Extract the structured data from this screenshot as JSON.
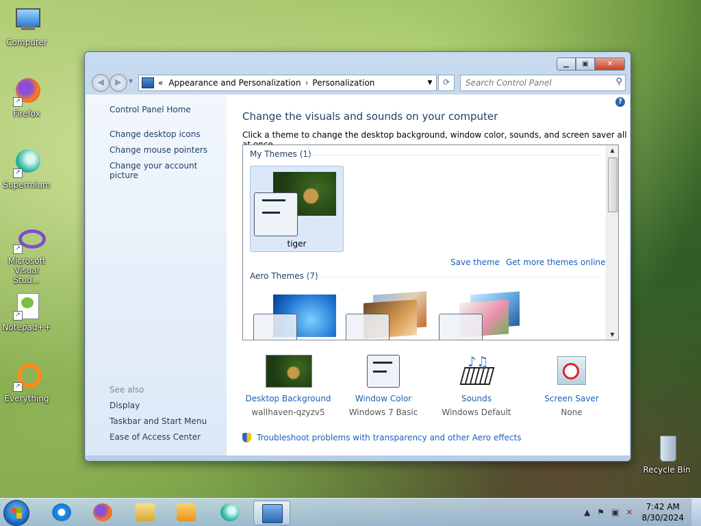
{
  "desktop": {
    "icons": [
      {
        "label": "Computer"
      },
      {
        "label": "Firefox"
      },
      {
        "label": "Supermium"
      },
      {
        "label": "Microsoft Visual Stud..."
      },
      {
        "label": "Notepad++"
      },
      {
        "label": "Everything"
      },
      {
        "label": "Recycle Bin"
      }
    ]
  },
  "window": {
    "breadcrumb_prefix": "«",
    "breadcrumb": [
      "Appearance and Personalization",
      "Personalization"
    ],
    "search_placeholder": "Search Control Panel",
    "sidebar": {
      "home": "Control Panel Home",
      "links": [
        "Change desktop icons",
        "Change mouse pointers",
        "Change your account picture"
      ],
      "see_also_title": "See also",
      "see_also": [
        "Display",
        "Taskbar and Start Menu",
        "Ease of Access Center"
      ]
    },
    "title": "Change the visuals and sounds on your computer",
    "subtitle": "Click a theme to change the desktop background, window color, sounds, and screen saver all at once.",
    "my_themes_header": "My Themes (1)",
    "selected_theme": "tiger",
    "save_theme": "Save theme",
    "get_more": "Get more themes online",
    "aero_header": "Aero Themes (7)",
    "bottom": [
      {
        "label": "Desktop Background",
        "value": "wallhaven-qzyzv5"
      },
      {
        "label": "Window Color",
        "value": "Windows 7 Basic"
      },
      {
        "label": "Sounds",
        "value": "Windows Default"
      },
      {
        "label": "Screen Saver",
        "value": "None"
      }
    ],
    "troubleshoot": "Troubleshoot problems with transparency and other Aero effects"
  },
  "taskbar": {
    "time": "7:42 AM",
    "date": "8/30/2024"
  }
}
